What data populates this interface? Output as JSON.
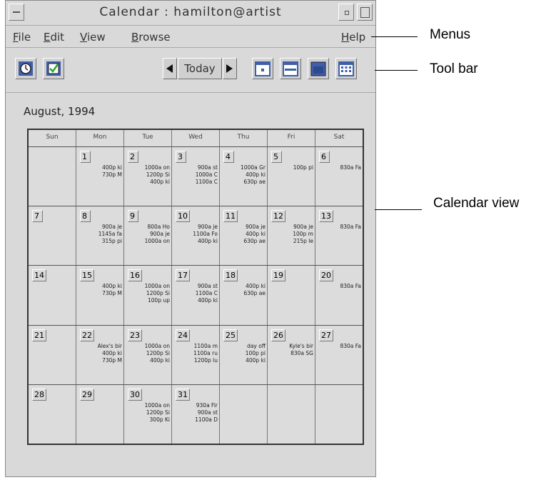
{
  "window": {
    "title": "Calendar : hamilton@artist"
  },
  "menus": {
    "file": {
      "mnemonic": "F",
      "rest": "ile"
    },
    "edit": {
      "mnemonic": "E",
      "rest": "dit"
    },
    "view": {
      "mnemonic": "V",
      "rest": "iew"
    },
    "browse": {
      "mnemonic": "B",
      "rest": "rowse"
    },
    "help": {
      "mnemonic": "H",
      "rest": "elp"
    }
  },
  "toolbar": {
    "today_label": "Today",
    "icons": [
      "clock-icon",
      "todo-check-icon",
      "prev-arrow-icon",
      "next-arrow-icon",
      "day-view-icon",
      "week-view-icon",
      "month-view-icon",
      "year-view-icon"
    ]
  },
  "month_label": "August, 1994",
  "days_of_week": [
    "Sun",
    "Mon",
    "Tue",
    "Wed",
    "Thu",
    "Fri",
    "Sat"
  ],
  "weeks": [
    [
      {
        "num": "",
        "appts": []
      },
      {
        "num": "1",
        "appts": [
          "400p ki",
          "730p M"
        ]
      },
      {
        "num": "2",
        "appts": [
          "1000a on",
          "1200p Si",
          "400p ki"
        ]
      },
      {
        "num": "3",
        "appts": [
          "900a st",
          "1000a C",
          "1100a C"
        ]
      },
      {
        "num": "4",
        "appts": [
          "1000a Gr",
          "400p ki",
          "630p ae"
        ]
      },
      {
        "num": "5",
        "appts": [
          "100p pi"
        ]
      },
      {
        "num": "6",
        "appts": [
          "830a Fa"
        ]
      }
    ],
    [
      {
        "num": "7",
        "appts": []
      },
      {
        "num": "8",
        "appts": [
          "900a je",
          "1145a fa",
          "315p pi"
        ]
      },
      {
        "num": "9",
        "appts": [
          "800a Ho",
          "900a je",
          "1000a on"
        ]
      },
      {
        "num": "10",
        "appts": [
          "900a je",
          "1100a Fo",
          "400p ki"
        ]
      },
      {
        "num": "11",
        "appts": [
          "900a je",
          "400p ki",
          "630p ae"
        ]
      },
      {
        "num": "12",
        "appts": [
          "900a je",
          "100p m",
          "215p le"
        ]
      },
      {
        "num": "13",
        "appts": [
          "830a Fa"
        ]
      }
    ],
    [
      {
        "num": "14",
        "appts": []
      },
      {
        "num": "15",
        "appts": [
          "400p ki",
          "730p M"
        ]
      },
      {
        "num": "16",
        "appts": [
          "1000a on",
          "1200p Si",
          "100p up"
        ]
      },
      {
        "num": "17",
        "appts": [
          "900a st",
          "1100a C",
          "400p ki"
        ]
      },
      {
        "num": "18",
        "appts": [
          "400p ki",
          "630p ae"
        ]
      },
      {
        "num": "19",
        "appts": []
      },
      {
        "num": "20",
        "appts": [
          "830a Fa"
        ]
      }
    ],
    [
      {
        "num": "21",
        "appts": []
      },
      {
        "num": "22",
        "appts": [
          "Alex's bir",
          "400p ki",
          "730p M"
        ]
      },
      {
        "num": "23",
        "appts": [
          "1000a on",
          "1200p Si",
          "400p ki"
        ]
      },
      {
        "num": "24",
        "appts": [
          "1100a m",
          "1100a ru",
          "1200p lu"
        ]
      },
      {
        "num": "25",
        "appts": [
          "day off",
          "100p pi",
          "400p ki"
        ]
      },
      {
        "num": "26",
        "appts": [
          "Kyle's bir",
          "830a SG"
        ]
      },
      {
        "num": "27",
        "appts": [
          "830a Fa"
        ]
      }
    ],
    [
      {
        "num": "28",
        "appts": []
      },
      {
        "num": "29",
        "appts": []
      },
      {
        "num": "30",
        "appts": [
          "1000a on",
          "1200p Si",
          "300p Ki"
        ]
      },
      {
        "num": "31",
        "appts": [
          "930a Fir",
          "900a st",
          "1100a D"
        ]
      },
      {
        "num": "",
        "appts": []
      },
      {
        "num": "",
        "appts": []
      },
      {
        "num": "",
        "appts": []
      }
    ]
  ],
  "callouts": {
    "menus": "Menus",
    "toolbar": "Tool bar",
    "calendar_view": "Calendar view"
  }
}
